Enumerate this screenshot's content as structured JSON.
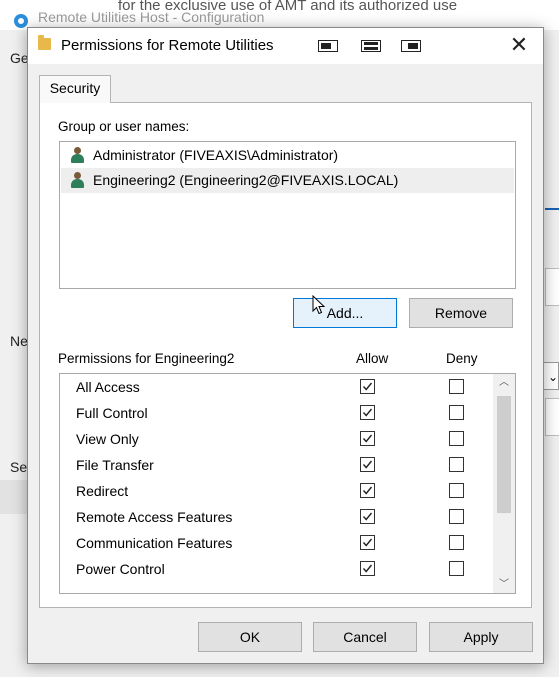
{
  "background": {
    "window_title": "Remote Utilities Host - Configuration",
    "top_text": "for the exclusive use of AMT and its authorized use",
    "left_labels": [
      "Ge",
      "Ne",
      "Se"
    ]
  },
  "dialog": {
    "title": "Permissions for Remote Utilities",
    "tab_label": "Security",
    "group_label": "Group or user names:",
    "users": [
      {
        "name": "Administrator (FIVEAXIS\\Administrator)",
        "selected": false
      },
      {
        "name": "Engineering2 (Engineering2@FIVEAXIS.LOCAL)",
        "selected": true
      }
    ],
    "add_label": "Add...",
    "remove_label": "Remove",
    "permissions_label": "Permissions for Engineering2",
    "allow_header": "Allow",
    "deny_header": "Deny",
    "permissions": [
      {
        "name": "All Access",
        "allow": true,
        "deny": false
      },
      {
        "name": "Full Control",
        "allow": true,
        "deny": false
      },
      {
        "name": "View Only",
        "allow": true,
        "deny": false
      },
      {
        "name": "File Transfer",
        "allow": true,
        "deny": false
      },
      {
        "name": "Redirect",
        "allow": true,
        "deny": false
      },
      {
        "name": "Remote Access Features",
        "allow": true,
        "deny": false
      },
      {
        "name": "Communication Features",
        "allow": true,
        "deny": false
      },
      {
        "name": "Power Control",
        "allow": true,
        "deny": false
      }
    ],
    "ok_label": "OK",
    "cancel_label": "Cancel",
    "apply_label": "Apply"
  },
  "icons": {
    "title": "folder-icon",
    "user": "user-icon",
    "close": "close-icon",
    "scroll_up": "chevron-up-icon",
    "scroll_down": "chevron-down-icon"
  },
  "colors": {
    "accent": "#0078d7",
    "user_body": "#2e7d5b",
    "folder": "#e8b84a"
  }
}
